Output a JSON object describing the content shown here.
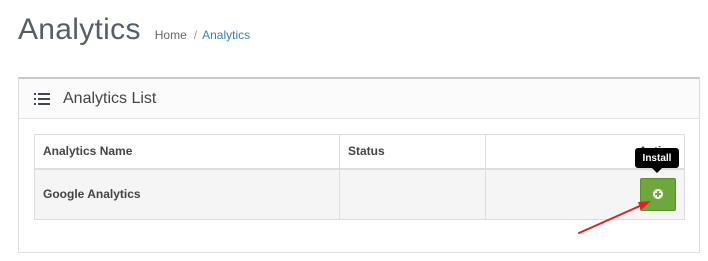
{
  "header": {
    "title": "Analytics",
    "breadcrumb": {
      "home": "Home",
      "separator": "/",
      "current": "Analytics"
    }
  },
  "panel": {
    "title": "Analytics List",
    "icon": "list-icon"
  },
  "table": {
    "columns": [
      "Analytics Name",
      "Status",
      "Action"
    ],
    "rows": [
      {
        "name": "Google Analytics",
        "status": "",
        "action_icon": "plus-circle-icon"
      }
    ]
  },
  "tooltip": {
    "text": "Install"
  },
  "annotation": {
    "arrow_color": "#e02020"
  },
  "colors": {
    "install_button": "#6ea83c",
    "breadcrumb_link": "#3a7fb0",
    "tooltip_bg": "#000000"
  }
}
